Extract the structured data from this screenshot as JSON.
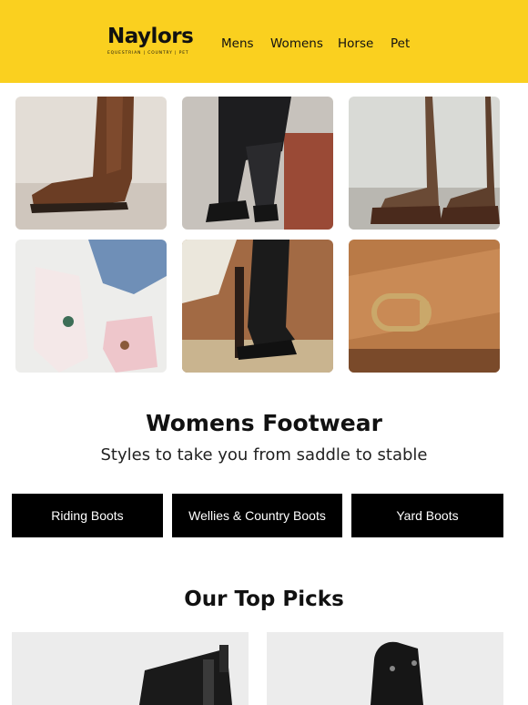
{
  "header": {
    "logo_text": "Naylors",
    "logo_tagline": "EQUESTRIAN | COUNTRY | PET",
    "nav": [
      {
        "label": "Mens"
      },
      {
        "label": "Womens"
      },
      {
        "label": "Horse"
      },
      {
        "label": "Pet"
      }
    ],
    "background_color": "#FAD01F"
  },
  "gallery": [
    {
      "subject": "brown-country-boots"
    },
    {
      "subject": "black-riding-trainers"
    },
    {
      "subject": "brown-suede-gaiters"
    },
    {
      "subject": "pink-yard-trainers"
    },
    {
      "subject": "black-long-riding-boot-in-stirrup"
    },
    {
      "subject": "tan-leather-buckle-strap"
    }
  ],
  "section": {
    "title": "Womens Footwear",
    "subtitle": "Styles to take you from saddle to stable"
  },
  "categories": [
    {
      "label": "Riding Boots"
    },
    {
      "label": "Wellies & Country Boots"
    },
    {
      "label": "Yard Boots"
    }
  ],
  "top_picks": {
    "title": "Our Top Picks",
    "products": [
      {
        "subject": "black-jodhpur-boot"
      },
      {
        "subject": "black-leather-chap"
      }
    ]
  }
}
